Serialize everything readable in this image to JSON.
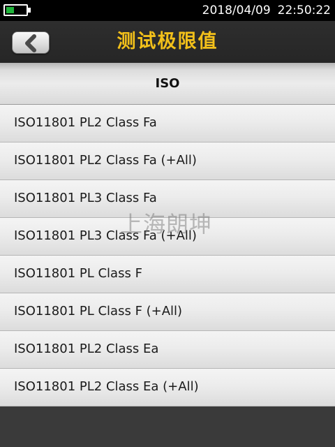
{
  "status_bar": {
    "date": "2018/04/09",
    "time": "22:50:22",
    "battery_level": 0.4,
    "battery_color": "#1fb43a"
  },
  "header": {
    "back_icon": "chevron-left-icon",
    "title": "测试极限值",
    "title_color": "#f2c01a"
  },
  "section": {
    "title": "ISO"
  },
  "limits": [
    {
      "label": "ISO11801 PL2 Class Fa"
    },
    {
      "label": "ISO11801 PL2 Class Fa (+All)"
    },
    {
      "label": "ISO11801 PL3 Class Fa"
    },
    {
      "label": "ISO11801 PL3 Class Fa (+All)"
    },
    {
      "label": "ISO11801 PL Class F"
    },
    {
      "label": "ISO11801 PL Class F (+All)"
    },
    {
      "label": "ISO11801 PL2 Class Ea"
    },
    {
      "label": "ISO11801 PL2 Class Ea (+All)"
    }
  ],
  "watermark": "上海朗坤"
}
